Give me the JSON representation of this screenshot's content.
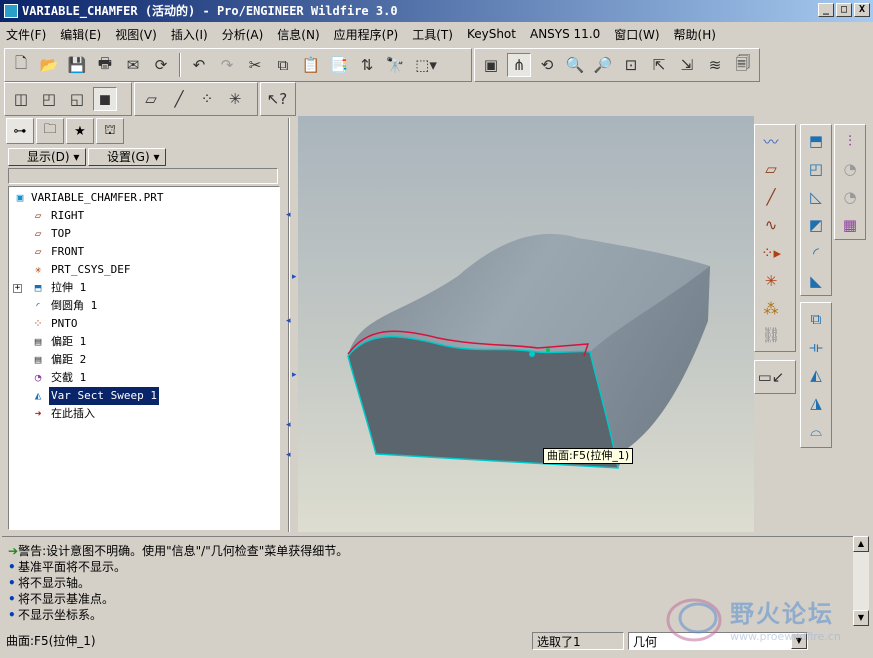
{
  "window": {
    "title": "VARIABLE_CHAMFER (活动的) - Pro/ENGINEER Wildfire 3.0",
    "minimize": "_",
    "maximize": "□",
    "close": "X"
  },
  "menu": [
    "文件(F)",
    "编辑(E)",
    "视图(V)",
    "插入(I)",
    "分析(A)",
    "信息(N)",
    "应用程序(P)",
    "工具(T)",
    "KeyShot",
    "ANSYS 11.0",
    "窗口(W)",
    "帮助(H)"
  ],
  "panel": {
    "show_label": "显示(D)",
    "settings_label": "设置(G)"
  },
  "tree": {
    "root": "VARIABLE_CHAMFER.PRT",
    "items": [
      "RIGHT",
      "TOP",
      "FRONT",
      "PRT_CSYS_DEF",
      "拉伸 1",
      "倒圆角 1",
      "PNTO",
      "偏距 1",
      "偏距 2",
      "交截 1",
      "Var Sect Sweep 1",
      "在此插入"
    ]
  },
  "viewport": {
    "tooltip": "曲面:F5(拉伸_1)"
  },
  "messages": [
    {
      "type": "warning",
      "text": "警告:设计意图不明确。使用\"信息\"/\"几何检查\"菜单获得细节。"
    },
    {
      "type": "info",
      "text": "基准平面将不显示。"
    },
    {
      "type": "info",
      "text": "将不显示轴。"
    },
    {
      "type": "info",
      "text": "将不显示基准点。"
    },
    {
      "type": "info",
      "text": "不显示坐标系。"
    }
  ],
  "status": {
    "left": "曲面:F5(拉伸_1)",
    "selected": "选取了1",
    "filter": "几何"
  },
  "watermark": {
    "name": "野火论坛",
    "url": "www.proewildfire.cn"
  },
  "colors": {
    "title_start": "#0a246a",
    "title_end": "#a6caf0",
    "selection": "#0a246a",
    "model_face": "#5a656e",
    "model_top": "#8f9ba4",
    "edge": "#00c8c8",
    "highlight": "#d4143c"
  }
}
